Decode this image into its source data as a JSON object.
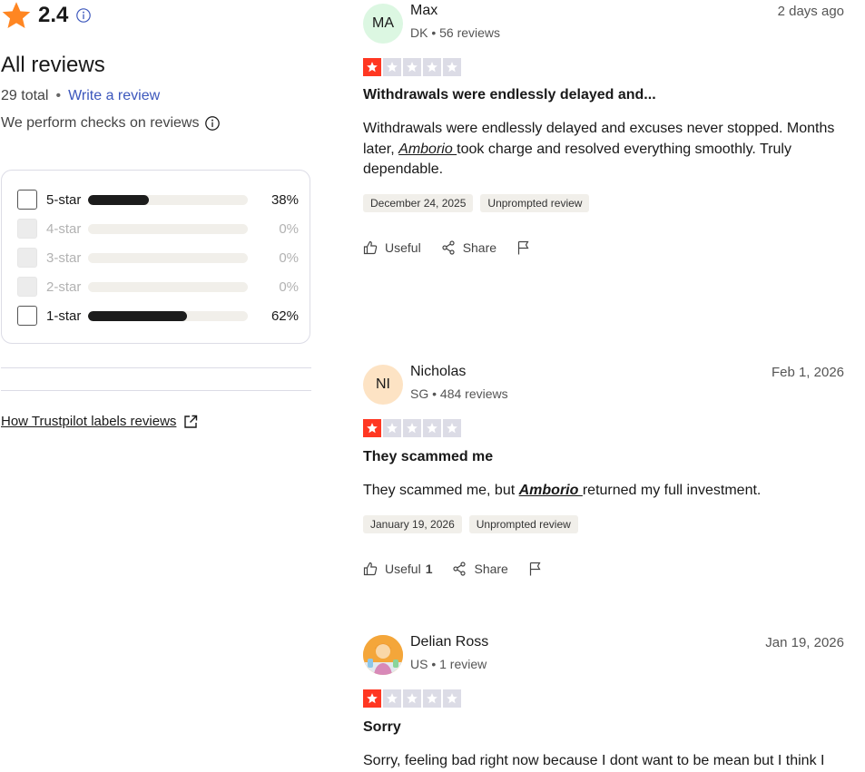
{
  "summary": {
    "rating": "2.4",
    "heading": "All reviews",
    "total": "29 total",
    "separator": "•",
    "write_review": "Write a review",
    "checks_note": "We perform checks on reviews",
    "labels_link": "How Trustpilot labels reviews"
  },
  "filters": [
    {
      "label": "5-star",
      "percent": "38%",
      "fill": 0.38,
      "enabled": true
    },
    {
      "label": "4-star",
      "percent": "0%",
      "fill": 0,
      "enabled": false
    },
    {
      "label": "3-star",
      "percent": "0%",
      "fill": 0,
      "enabled": false
    },
    {
      "label": "2-star",
      "percent": "0%",
      "fill": 0,
      "enabled": false
    },
    {
      "label": "1-star",
      "percent": "62%",
      "fill": 0.62,
      "enabled": true
    }
  ],
  "colors": {
    "brand_star": "#ff8622",
    "star_red": "#ff3722",
    "star_empty": "#dcdce6",
    "link_blue": "#3c57bc",
    "bar_fill": "#1c1c1c",
    "bar_track": "#f1efea"
  },
  "reviews": [
    {
      "initials": "MA",
      "avatar_color": "#dcf7e2",
      "name": "Max",
      "meta": "DK • 56 reviews",
      "date": "2 days ago",
      "stars": 1,
      "title": "Withdrawals were endlessly delayed and...",
      "body_before": "Withdrawals were endlessly delayed and excuses never stopped. Months later, ",
      "body_link": "Amborio ",
      "body_after": "took charge and resolved everything smoothly. Truly dependable.",
      "experience_date": "December 24, 2025",
      "badge": "Unprompted review",
      "useful": "Useful",
      "useful_count": "",
      "share": "Share"
    },
    {
      "initials": "NI",
      "avatar_color": "#fde3c4",
      "name": "Nicholas",
      "meta": "SG • 484 reviews",
      "date": "Feb 1, 2026",
      "stars": 1,
      "title": "They scammed me",
      "body_before": "They scammed me, but ",
      "body_link": "Amborio ",
      "body_after": "returned my full investment.",
      "experience_date": "January 19, 2026",
      "badge": "Unprompted review",
      "useful": "Useful",
      "useful_count": "1",
      "share": "Share"
    },
    {
      "initials": "",
      "avatar_color": "#f4a63a",
      "name": "Delian Ross",
      "meta": "US • 1 review",
      "date": "Jan 19, 2026",
      "stars": 1,
      "title": "Sorry",
      "body_before": "Sorry, feeling bad right now because I dont want to be mean but I think I",
      "body_link": "",
      "body_after": ""
    }
  ]
}
